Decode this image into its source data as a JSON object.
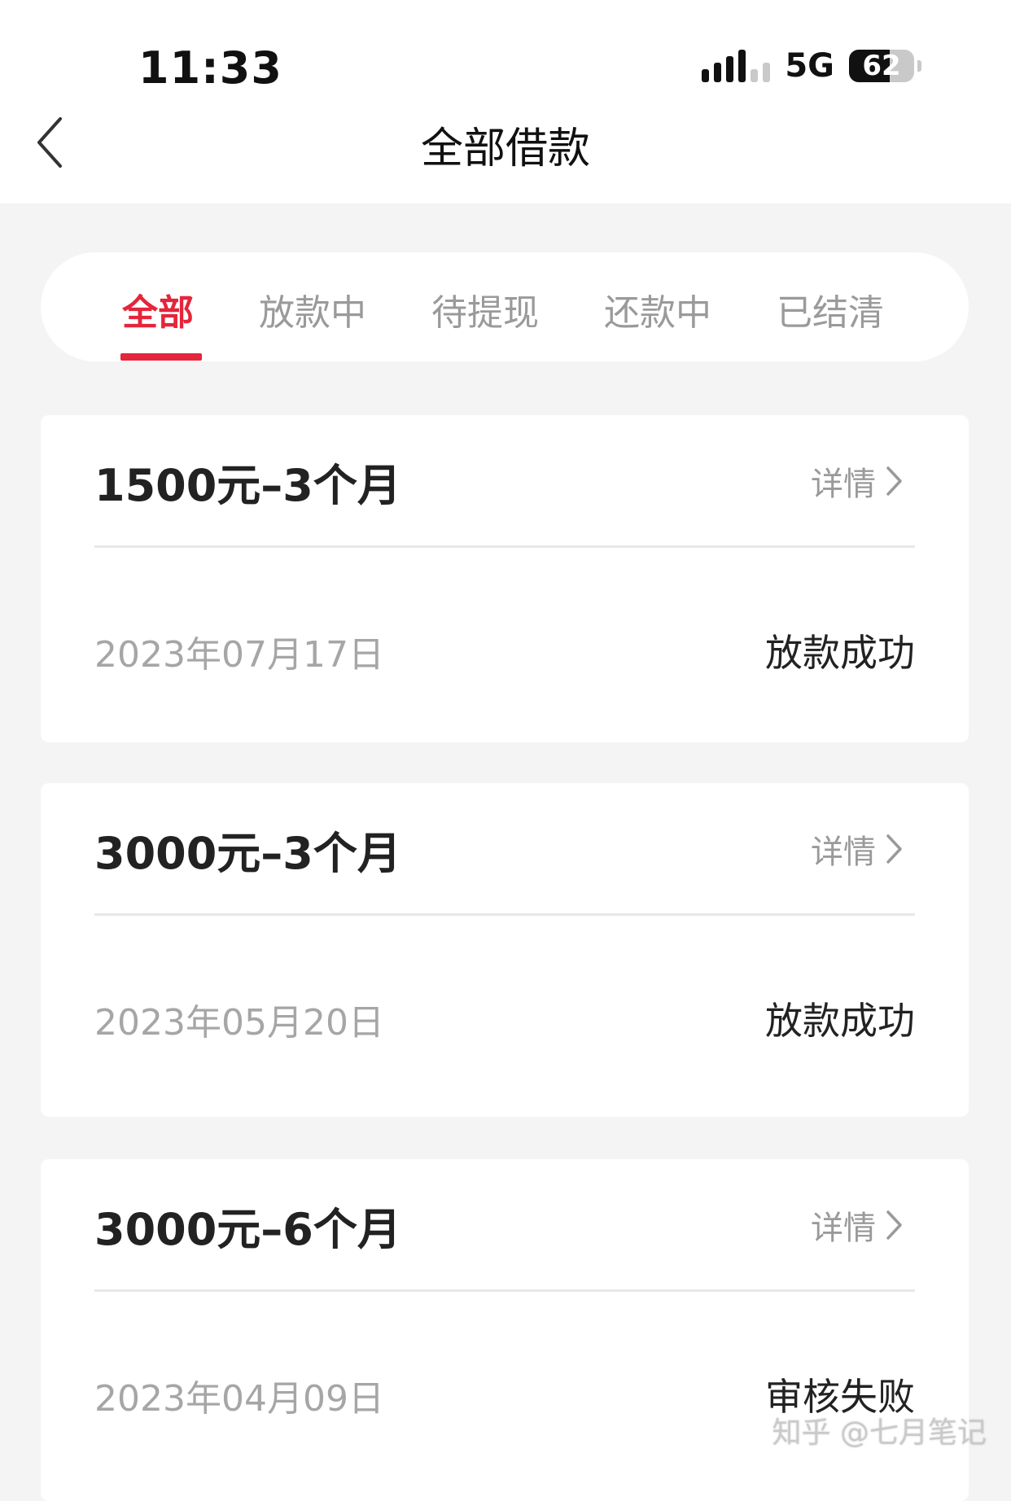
{
  "status_bar": {
    "time": "11:33",
    "network": "5G",
    "battery": "62",
    "battery_level": 0.62
  },
  "header": {
    "title": "全部借款",
    "back_icon": "chevron-left-icon"
  },
  "tabs": [
    {
      "label": "全部",
      "active": true
    },
    {
      "label": "放款中",
      "active": false
    },
    {
      "label": "待提现",
      "active": false
    },
    {
      "label": "还款中",
      "active": false
    },
    {
      "label": "已结清",
      "active": false
    }
  ],
  "loans": [
    {
      "title": "1500元–3个月",
      "detail": "详情",
      "date": "2023年07月17日",
      "status": "放款成功"
    },
    {
      "title": "3000元–3个月",
      "detail": "详情",
      "date": "2023年05月20日",
      "status": "放款成功"
    },
    {
      "title": "3000元–6个月",
      "detail": "详情",
      "date": "2023年04月09日",
      "status": "审核失败"
    }
  ],
  "watermark": "知乎 @七月笔记",
  "colors": {
    "accent": "#e5253b",
    "background": "#f4f4f5"
  }
}
